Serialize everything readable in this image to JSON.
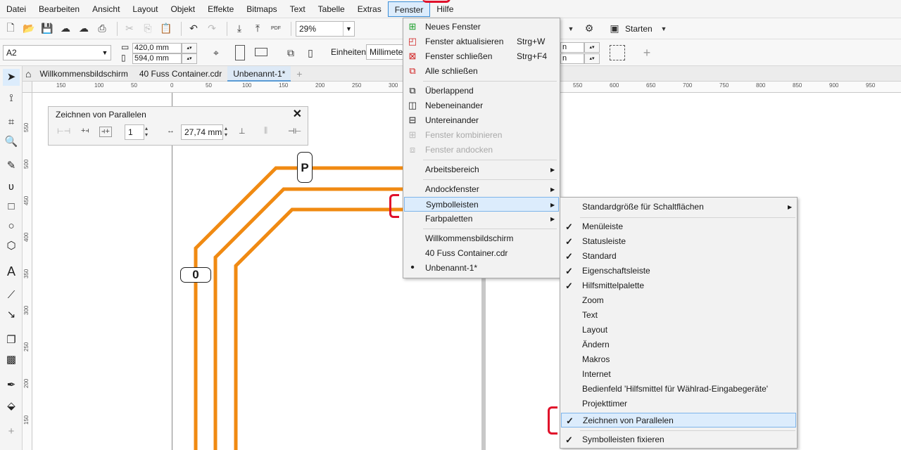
{
  "menubar": {
    "items": [
      "Datei",
      "Bearbeiten",
      "Ansicht",
      "Layout",
      "Objekt",
      "Effekte",
      "Bitmaps",
      "Text",
      "Tabelle",
      "Extras",
      "Fenster",
      "Hilfe"
    ],
    "active": "Fenster"
  },
  "toolbar": {
    "zoom": "29%",
    "start_label": "Starten",
    "pdf_label": "PDF"
  },
  "property_bar": {
    "page_preset": "A2",
    "width": "420,0 mm",
    "height": "594,0 mm",
    "units_label": "Einheiten:",
    "units_value": "Millimeter",
    "nudge_1": "n",
    "nudge_2": "n"
  },
  "tabs": [
    "Willkommensbildschirm",
    "40 Fuss Container.cdr",
    "Unbenannt-1*"
  ],
  "ruler": {
    "h_ticks": [
      "150",
      "100",
      "50",
      "0",
      "50",
      "100",
      "150",
      "200",
      "250",
      "300",
      "550",
      "600",
      "650",
      "700",
      "750",
      "800",
      "850",
      "900",
      "950"
    ],
    "v_ticks": [
      "550",
      "500",
      "450",
      "400",
      "350",
      "300",
      "250",
      "200",
      "150"
    ]
  },
  "docker": {
    "title": "Zeichnen von Parallelen",
    "count": "1",
    "distance": "27,74 mm"
  },
  "canvas": {
    "badge_p": "P",
    "badge_o": "0",
    "line_color": "#f08a12"
  },
  "fenster_menu": {
    "items": [
      {
        "label": "Neues Fenster",
        "icon": "new-window-icon"
      },
      {
        "label": "Fenster aktualisieren",
        "shortcut": "Strg+W",
        "icon": "refresh-window-icon"
      },
      {
        "label": "Fenster schließen",
        "shortcut": "Strg+F4",
        "icon": "close-window-icon"
      },
      {
        "label": "Alle schließen",
        "icon": "close-all-icon"
      },
      {
        "label": "Überlappend",
        "icon": "cascade-icon"
      },
      {
        "label": "Nebeneinander",
        "icon": "tile-vertical-icon"
      },
      {
        "label": "Untereinander",
        "icon": "tile-horizontal-icon"
      },
      {
        "label": "Fenster kombinieren",
        "icon": "combine-icon"
      },
      {
        "label": "Fenster andocken",
        "icon": "dock-icon"
      },
      {
        "label": "Arbeitsbereich"
      },
      {
        "label": "Andockfenster"
      },
      {
        "label": "Symbolleisten"
      },
      {
        "label": "Farbpaletten"
      },
      {
        "label": "Willkommensbildschirm"
      },
      {
        "label": "40 Fuss Container.cdr"
      },
      {
        "label": "Unbenannt-1*"
      }
    ]
  },
  "symbolleisten_menu": {
    "items": [
      {
        "label": "Standardgröße für Schaltflächen",
        "checked": false
      },
      {
        "label": "Menüleiste",
        "checked": true
      },
      {
        "label": "Statusleiste",
        "checked": true
      },
      {
        "label": "Standard",
        "checked": true
      },
      {
        "label": "Eigenschaftsleiste",
        "checked": true
      },
      {
        "label": "Hilfsmittelpalette",
        "checked": true
      },
      {
        "label": "Zoom",
        "checked": false
      },
      {
        "label": "Text",
        "checked": false
      },
      {
        "label": "Layout",
        "checked": false
      },
      {
        "label": "Ändern",
        "checked": false
      },
      {
        "label": "Makros",
        "checked": false
      },
      {
        "label": "Internet",
        "checked": false
      },
      {
        "label": "Bedienfeld 'Hilfsmittel für Wählrad-Eingabegeräte'",
        "checked": false
      },
      {
        "label": "Projekttimer",
        "checked": false
      },
      {
        "label": "Zeichnen von Parallelen",
        "checked": true
      },
      {
        "label": "Symbolleisten fixieren",
        "checked": true
      }
    ]
  }
}
